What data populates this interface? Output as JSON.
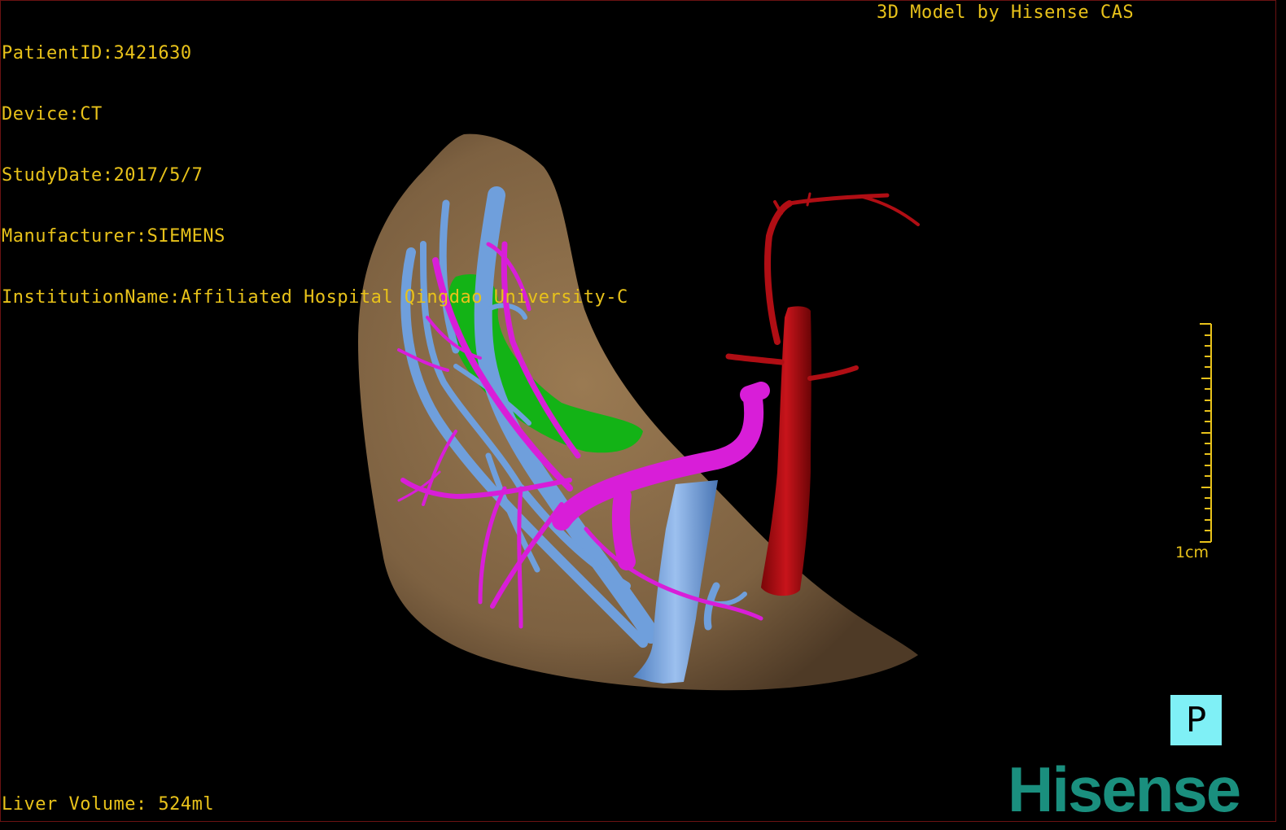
{
  "patient_info": {
    "patient_id": "PatientID:3421630",
    "device": "Device:CT",
    "study_date": "StudyDate:2017/5/7",
    "manufacturer": "Manufacturer:SIEMENS",
    "institution": "InstitutionName:Affiliated Hospital Qingdao University-C"
  },
  "credit": "3D Model by Hisense CAS",
  "liver_volume": "Liver Volume: 524ml",
  "scale_bar": {
    "label": "1cm"
  },
  "orientation_marker": "P",
  "logo": "Hisense",
  "colors": {
    "overlay_text": "#e8c21a",
    "liver": "#8a6a45",
    "portal_vein": "#d81ed8",
    "hepatic_vein": "#6f9fdc",
    "artery": "#b00e14",
    "gallbladder": "#13b316",
    "orientation_box": "#7ff0f6",
    "logo": "#1a8f7e"
  }
}
